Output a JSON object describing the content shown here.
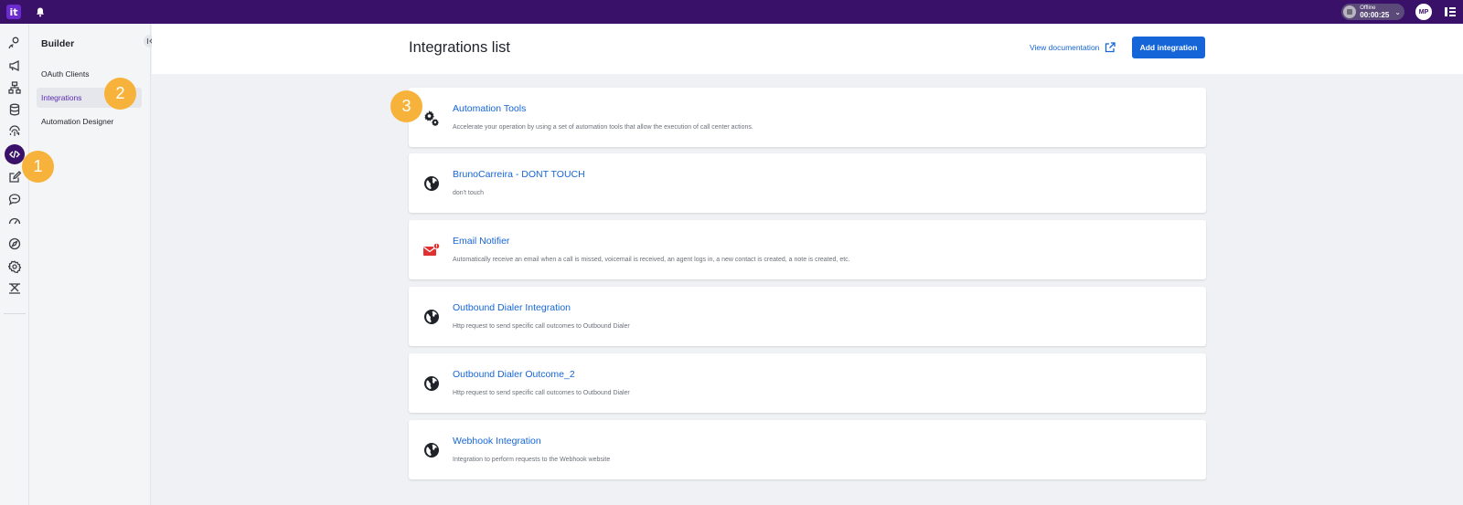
{
  "topbar": {
    "logo_text": "it",
    "status_label": "Offline",
    "status_time": "00:00:25",
    "avatar_initials": "MP",
    "colors": {
      "bar": "#3a1168",
      "accent": "#1565d8",
      "badge": "#f7b23b"
    }
  },
  "rail": {
    "icons": [
      "wave-user-icon",
      "megaphone-icon",
      "flow-icon",
      "database-icon",
      "fingerprint-icon",
      "code-icon",
      "edit-icon",
      "chat-icon",
      "gauge-icon",
      "compass-icon",
      "gear-icon",
      "switchboard-icon"
    ],
    "active": "code-icon"
  },
  "panel": {
    "title": "Builder",
    "items": [
      {
        "label": "OAuth Clients"
      },
      {
        "label": "Integrations"
      },
      {
        "label": "Automation Designer"
      }
    ],
    "active_item": "Integrations"
  },
  "header": {
    "title": "Integrations list",
    "doc_link": "View documentation",
    "add_button": "Add integration"
  },
  "integrations": [
    {
      "title": "Automation Tools",
      "description": "Accelerate your operation by using a set of automation tools that allow the execution of call center actions.",
      "icon": "gears-icon"
    },
    {
      "title": "BrunoCarreira - DONT TOUCH",
      "description": "don't touch",
      "icon": "globe-icon"
    },
    {
      "title": "Email Notifier",
      "description": "Automatically receive an email when a call is missed, voicemail is received, an agent logs in, a new contact is created, a note is created, etc.",
      "icon": "email-notifier-icon"
    },
    {
      "title": "Outbound Dialer Integration",
      "description": "Http request to send specific call outcomes to Outbound Dialer",
      "icon": "globe-icon"
    },
    {
      "title": "Outbound Dialer Outcome_2",
      "description": "Http request to send specific call outcomes to Outbound Dialer",
      "icon": "globe-icon"
    },
    {
      "title": "Webhook Integration",
      "description": "Integration to perform requests to the Webhook website",
      "icon": "globe-icon"
    }
  ],
  "callouts": [
    "1",
    "2",
    "3"
  ]
}
